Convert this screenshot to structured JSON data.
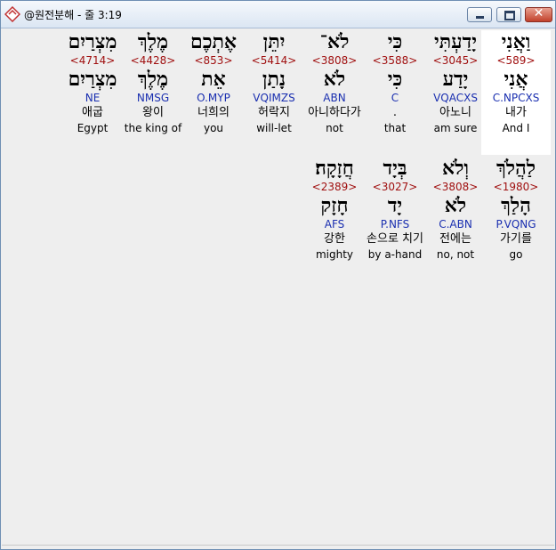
{
  "window": {
    "title": "@원전분해 - 줄 3:19",
    "app_icon": "diamond-app-icon",
    "controls": {
      "minimize": "minimize-icon",
      "maximize": "maximize-icon",
      "close": "close-icon"
    }
  },
  "colors": {
    "strongs": "#a01010",
    "morph": "#1a2fb0",
    "highlight": "#ffffff"
  },
  "rows": [
    [
      {
        "heb": "וַאֲנִי",
        "strongs": "<589>",
        "lemma": "אֲנִי",
        "morph": "C.NPCXS",
        "ko": "내가",
        "en": "And I",
        "highlight": true
      },
      {
        "heb": "יָדַעְתִּי",
        "strongs": "<3045>",
        "lemma": "יָדַע",
        "morph": "VQACXS",
        "ko": "아노니",
        "en": "am sure"
      },
      {
        "heb": "כִּי",
        "strongs": "<3588>",
        "lemma": "כִּי",
        "morph": "C",
        "ko": ".",
        "en": "that"
      },
      {
        "heb": "לֹא־",
        "strongs": "<3808>",
        "lemma": "לֹא",
        "morph": "ABN",
        "ko": "아니하다가",
        "en": "not"
      },
      {
        "heb": "יִתֵּן",
        "strongs": "<5414>",
        "lemma": "נָתַן",
        "morph": "VQIMZS",
        "ko": "허락지",
        "en": "will-let"
      },
      {
        "heb": "אֶתְכֶם",
        "strongs": "<853>",
        "lemma": "אֵת",
        "morph": "O.MYP",
        "ko": "너희의",
        "en": "you"
      },
      {
        "heb": "מֶלֶךְ",
        "strongs": "<4428>",
        "lemma": "מֶלֶךְ",
        "morph": "NMSG",
        "ko": "왕이",
        "en": "the king of"
      },
      {
        "heb": "מִצְרַיִם",
        "strongs": "<4714>",
        "lemma": "מִצְרַיִם",
        "morph": "NE",
        "ko": "애굽",
        "en": "Egypt"
      }
    ],
    [
      {
        "heb": "לַהֲלֹךְ",
        "strongs": "<1980>",
        "lemma": "הָלַךְ",
        "morph": "P.VQNG",
        "ko": "가기를",
        "en": "go"
      },
      {
        "heb": "וְלֹא",
        "strongs": "<3808>",
        "lemma": "לֹא",
        "morph": "C.ABN",
        "ko": "전에는",
        "en": "no, not"
      },
      {
        "heb": "בְּיָד",
        "strongs": "<3027>",
        "lemma": "יָד",
        "morph": "P.NFS",
        "ko": "손으로 치기",
        "en": "by a-hand"
      },
      {
        "heb": "חֲזָקָה׃",
        "strongs": "<2389>",
        "lemma": "חָזָק",
        "morph": "AFS",
        "ko": "강한",
        "en": "mighty"
      }
    ]
  ]
}
